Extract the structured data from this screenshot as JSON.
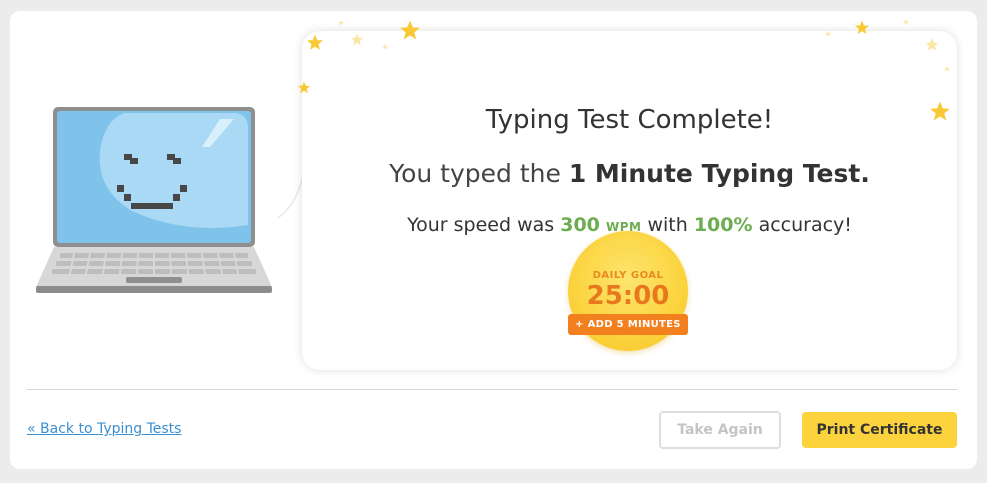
{
  "result": {
    "title": "Typing Test Complete!",
    "subtitle_prefix": "You typed the ",
    "subtitle_test_name": "1 Minute Typing Test.",
    "stats_prefix": "Your speed was ",
    "speed_value": "300",
    "speed_unit": "WPM",
    "stats_middle": " with ",
    "accuracy_value": "100%",
    "stats_suffix": " accuracy!"
  },
  "daily_goal": {
    "label": "DAILY GOAL",
    "time": "25:00",
    "add_button": "+ ADD 5 MINUTES"
  },
  "footer": {
    "back_link": "« Back to Typing Tests",
    "take_again": "Take Again",
    "print_certificate": "Print Certificate"
  },
  "colors": {
    "accent_yellow": "#fcd33c",
    "success_green": "#6cad52",
    "link_blue": "#3a8fd1",
    "badge_orange": "#f3801f"
  },
  "icons": {
    "mascot": "smiling-laptop-icon",
    "decoration": "star-icon"
  }
}
